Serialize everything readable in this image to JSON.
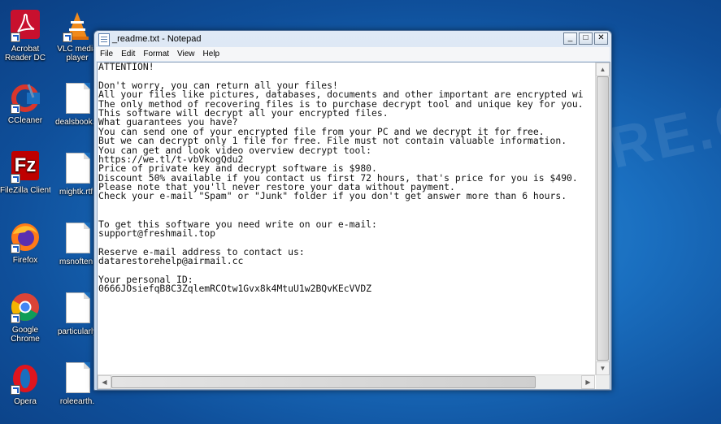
{
  "desktop": {
    "icons": [
      {
        "label1": "Acrobat",
        "label2": "Reader DC"
      },
      {
        "label1": "VLC media",
        "label2": "player"
      },
      {
        "label1": "CCleaner",
        "label2": ""
      },
      {
        "label1": "dealsbook.p",
        "label2": ""
      },
      {
        "label1": "FileZilla Client",
        "label2": ""
      },
      {
        "label1": "mightk.rtf.",
        "label2": ""
      },
      {
        "label1": "Firefox",
        "label2": ""
      },
      {
        "label1": "msnoften.",
        "label2": ""
      },
      {
        "label1": "Google",
        "label2": "Chrome"
      },
      {
        "label1": "particularly",
        "label2": ""
      },
      {
        "label1": "Opera",
        "label2": ""
      },
      {
        "label1": "roleearth.",
        "label2": ""
      }
    ]
  },
  "window": {
    "title": "_readme.txt - Notepad",
    "min_glyph": "_",
    "max_glyph": "□",
    "close_glyph": "✕",
    "menu": [
      "File",
      "Edit",
      "Format",
      "View",
      "Help"
    ]
  },
  "document": {
    "lines": [
      "ATTENTION!",
      "",
      "Don't worry, you can return all your files!",
      "All your files like pictures, databases, documents and other important are encrypted wi",
      "The only method of recovering files is to purchase decrypt tool and unique key for you.",
      "This software will decrypt all your encrypted files.",
      "What guarantees you have?",
      "You can send one of your encrypted file from your PC and we decrypt it for free.",
      "But we can decrypt only 1 file for free. File must not contain valuable information.",
      "You can get and look video overview decrypt tool:",
      "https://we.tl/t-vbVkogQdu2",
      "Price of private key and decrypt software is $980.",
      "Discount 50% available if you contact us first 72 hours, that's price for you is $490.",
      "Please note that you'll never restore your data without payment.",
      "Check your e-mail \"Spam\" or \"Junk\" folder if you don't get answer more than 6 hours.",
      "",
      "",
      "To get this software you need write on our e-mail:",
      "support@freshmail.top",
      "",
      "Reserve e-mail address to contact us:",
      "datarestorehelp@airmail.cc",
      "",
      "Your personal ID:",
      "0666JOsiefqB8C3ZqlemRCOtw1Gvx8k4MtuU1w2BQvKEcVVDZ"
    ]
  },
  "watermark": "MYANTISPYWARE.COM",
  "colors": {
    "desktop": "#1a6fc0",
    "titlebar": "#dfe9f5"
  }
}
